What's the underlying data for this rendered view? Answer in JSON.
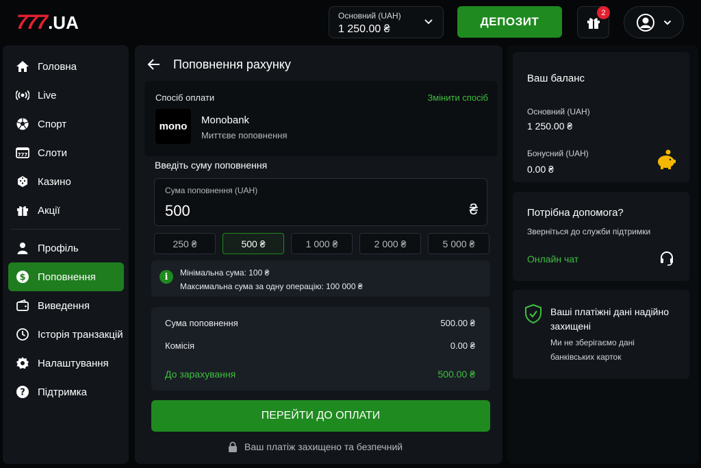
{
  "header": {
    "logo_number": "777",
    "logo_suffix": ".UA",
    "balance_label": "Основний (UAH)",
    "balance_value": "1 250.00 ₴",
    "deposit_label": "ДЕПОЗИТ",
    "gift_badge": "2"
  },
  "sidebar": {
    "items": [
      {
        "label": "Головна",
        "icon": "home-icon"
      },
      {
        "label": "Live",
        "icon": "live-broadcast-icon"
      },
      {
        "label": "Спорт",
        "icon": "soccer-ball-icon"
      },
      {
        "label": "Слоти",
        "icon": "slot-machine-icon"
      },
      {
        "label": "Казино",
        "icon": "dice-icon"
      },
      {
        "label": "Акції",
        "icon": "gift-icon"
      },
      {
        "label": "Профіль",
        "icon": "user-icon"
      },
      {
        "label": "Поповнення",
        "icon": "dollar-icon",
        "active": true
      },
      {
        "label": "Виведення",
        "icon": "wallet-icon"
      },
      {
        "label": "Історія транзакцій",
        "icon": "clock-icon"
      },
      {
        "label": "Налаштування",
        "icon": "gear-icon"
      },
      {
        "label": "Підтримка",
        "icon": "help-icon"
      }
    ]
  },
  "main": {
    "title": "Поповнення рахунку",
    "payment": {
      "title": "Спосіб оплати",
      "change_label": "Змінити спосіб",
      "logo_text": "mono",
      "name": "Monobank",
      "subtitle": "Миттєве поповнення"
    },
    "amount_heading": "Введіть суму поповнення",
    "amount_label": "Сума поповнення (UAH)",
    "amount_value": "500",
    "currency_symbol": "₴",
    "presets": [
      "250 ₴",
      "500 ₴",
      "1 000 ₴",
      "2 000 ₴",
      "5 000 ₴"
    ],
    "selected_preset": "500 ₴",
    "info": {
      "min": "Мінімальна сума: 100 ₴",
      "max": "Максимальна сума за одну операцію: 100 000 ₴"
    },
    "summary": {
      "deposit_label": "Сума поповнення",
      "deposit_value": "500.00 ₴",
      "fee_label": "Комісія",
      "fee_value": "0.00 ₴",
      "total_label": "До зарахування",
      "total_value": "500.00 ₴"
    },
    "pay_button": "ПЕРЕЙТИ ДО ОПЛАТИ",
    "secure_note": "Ваш платіж захищено та безпечний"
  },
  "right": {
    "balance": {
      "title": "Ваш баланс",
      "main_label": "Основний (UAH)",
      "main_value": "1 250.00 ₴",
      "bonus_label": "Бонусний (UAH)",
      "bonus_value": "0.00 ₴"
    },
    "help": {
      "title": "Потрібна допомога?",
      "subtitle": "Зверніться до служби підтримки",
      "chat_label": "Онлайн чат"
    },
    "security": {
      "title": "Ваші платіжні дані надійно захищені",
      "text": "Ми не зберігаємо дані банківських карток"
    }
  },
  "colors": {
    "accent_green": "#1f8a1f",
    "link_green": "#3fbf3f",
    "brand_red": "#e3202f",
    "background": "#050709",
    "panel": "#12161b"
  }
}
